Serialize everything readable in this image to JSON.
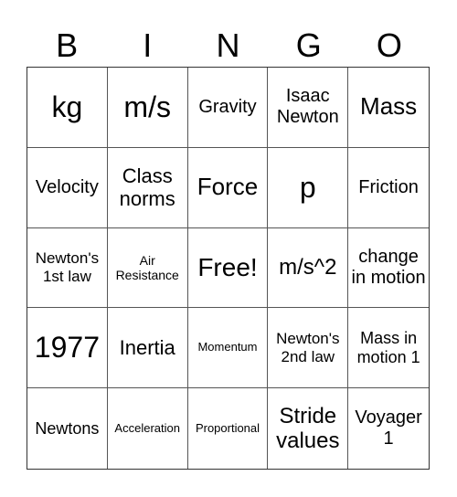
{
  "header": [
    "B",
    "I",
    "N",
    "G",
    "O"
  ],
  "cells": [
    "kg",
    "m/s",
    "Gravity",
    "Isaac Newton",
    "Mass",
    "Velocity",
    "Class norms",
    "Force",
    "p",
    "Friction",
    "Newton's 1st law",
    "Air Resistance",
    "Free!",
    "m/s^2",
    "change in motion",
    "1977",
    "Inertia",
    "Momentum",
    "Newton's 2nd law",
    "Mass in motion 1",
    "Newtons",
    "Acceleration",
    "Proportional",
    "Stride values",
    "Voyager 1"
  ]
}
